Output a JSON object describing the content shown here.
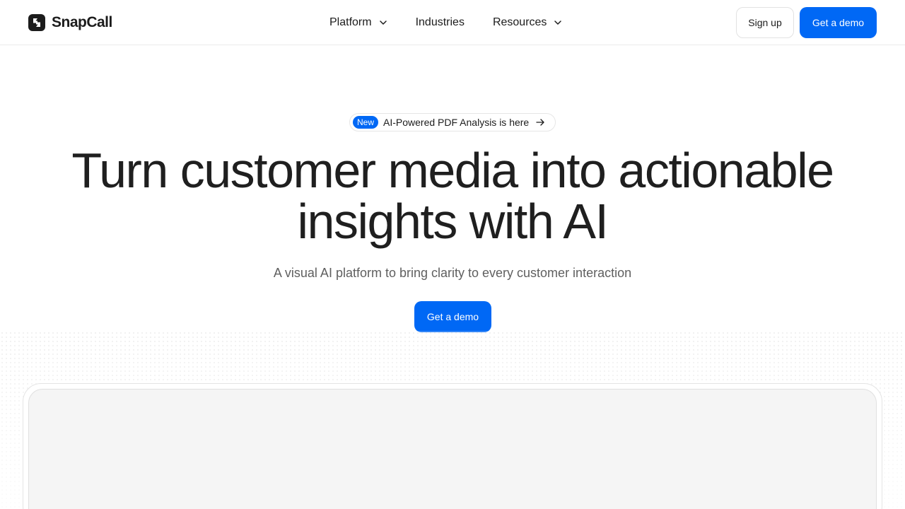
{
  "header": {
    "brand": "SnapCall",
    "nav": [
      {
        "label": "Platform",
        "has_dropdown": true
      },
      {
        "label": "Industries",
        "has_dropdown": false
      },
      {
        "label": "Resources",
        "has_dropdown": true
      }
    ],
    "signup_label": "Sign up",
    "demo_label": "Get a demo"
  },
  "hero": {
    "badge": "New",
    "announcement": "AI-Powered PDF Analysis is here",
    "headline_line1": "Turn customer media into actionable",
    "headline_line2": "insights with AI",
    "subheadline": "A visual AI platform to bring clarity to every customer interaction",
    "cta_label": "Get a demo"
  },
  "colors": {
    "accent": "#0068f5",
    "text": "#1c1c1c",
    "muted": "#5f5f5f",
    "preview_bg": "#f5f5f5"
  },
  "icons": [
    "snapcall-logo-icon",
    "chevron-down-icon",
    "arrow-right-icon"
  ]
}
